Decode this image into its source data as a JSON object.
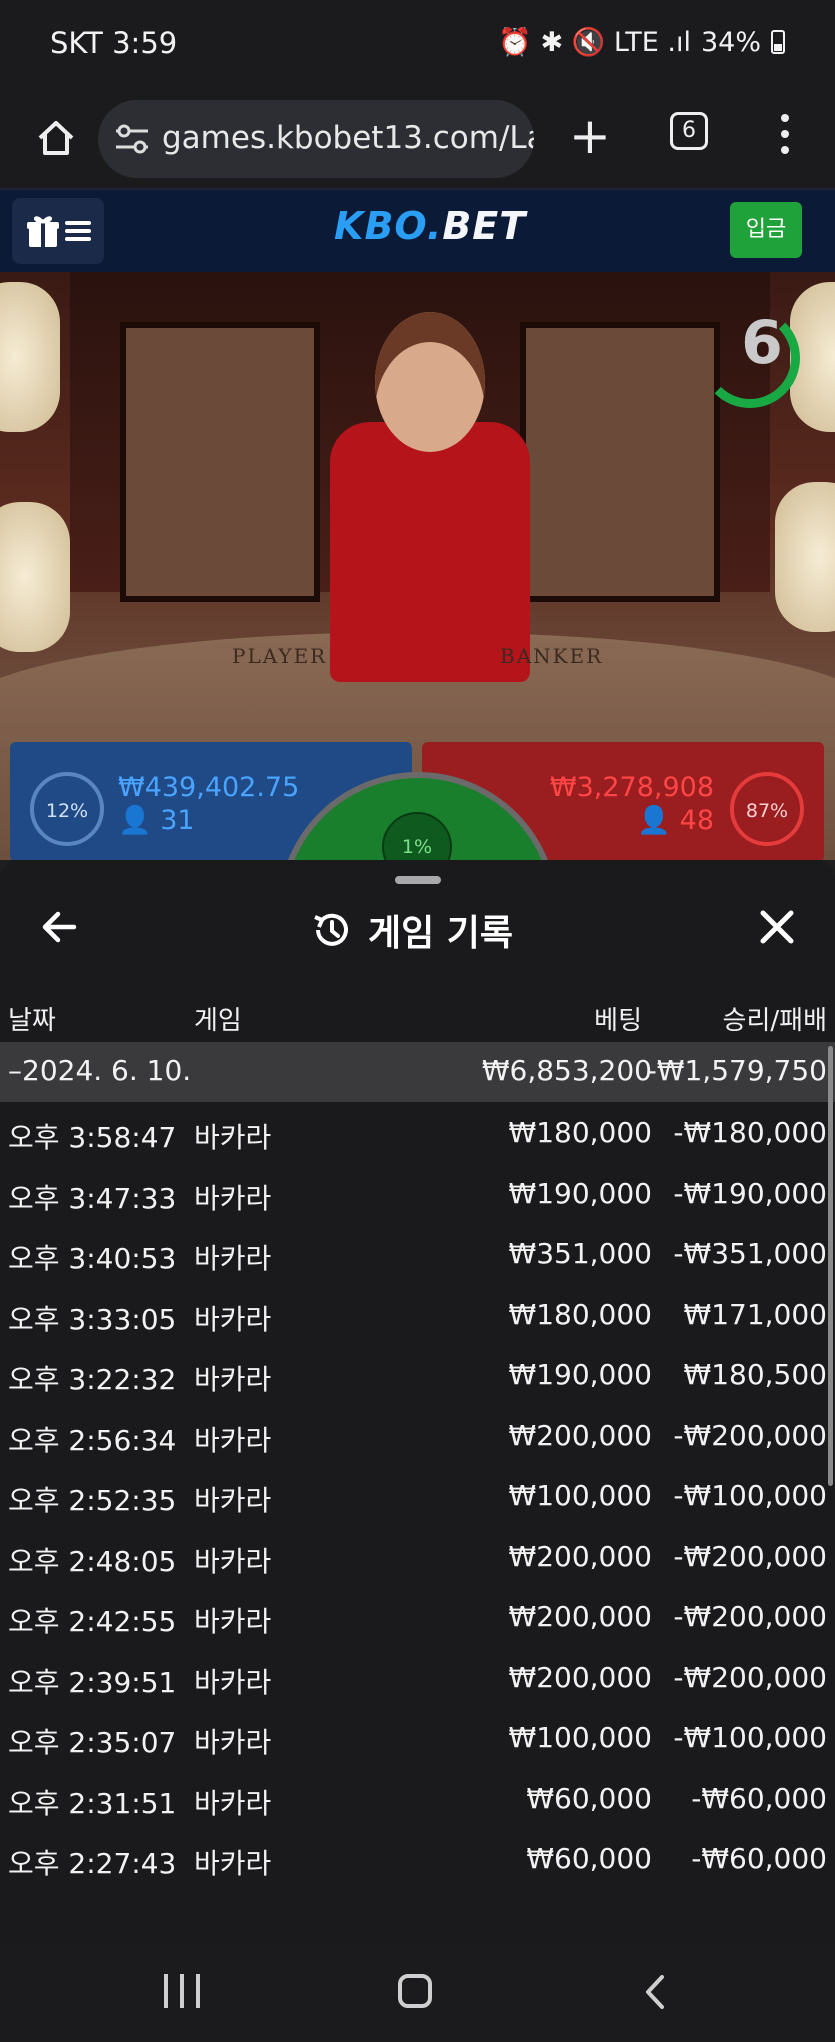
{
  "status_bar": {
    "time": "SKT 3:59",
    "indicators": "⏰ ✱ 🔇 LTE .ıl",
    "battery": "34%"
  },
  "browser": {
    "url": "games.kbobet13.com/La",
    "tab_count": "6",
    "icons": [
      "home-icon",
      "site-settings-icon",
      "plus-icon",
      "tabs-icon",
      "more-vert-icon"
    ]
  },
  "site_header": {
    "logo_part1": "KBO.",
    "logo_part2": "BET",
    "deposit_label": "입금"
  },
  "live_game": {
    "timer": "6",
    "table_player_text": "PLAYER",
    "table_banker_text": "BANKER",
    "player": {
      "pct": "12%",
      "amount": "₩439,402.75",
      "count": "31"
    },
    "banker": {
      "pct": "87%",
      "amount": "₩3,278,908",
      "count": "48"
    },
    "tie": {
      "pct": "1%"
    }
  },
  "history": {
    "title": "게임 기록",
    "columns": {
      "date": "날짜",
      "game": "게임",
      "bet": "베팅",
      "result": "승리/패배"
    },
    "date_group": {
      "date": "–2024. 6. 10.",
      "bet_total": "₩6,853,200",
      "result_total": "-₩1,579,750"
    },
    "rows": [
      {
        "time": "오후 3:58:47",
        "game": "바카라",
        "bet": "₩180,000",
        "result": "-₩180,000"
      },
      {
        "time": "오후 3:47:33",
        "game": "바카라",
        "bet": "₩190,000",
        "result": "-₩190,000"
      },
      {
        "time": "오후 3:40:53",
        "game": "바카라",
        "bet": "₩351,000",
        "result": "-₩351,000"
      },
      {
        "time": "오후 3:33:05",
        "game": "바카라",
        "bet": "₩180,000",
        "result": "₩171,000"
      },
      {
        "time": "오후 3:22:32",
        "game": "바카라",
        "bet": "₩190,000",
        "result": "₩180,500"
      },
      {
        "time": "오후 2:56:34",
        "game": "바카라",
        "bet": "₩200,000",
        "result": "-₩200,000"
      },
      {
        "time": "오후 2:52:35",
        "game": "바카라",
        "bet": "₩100,000",
        "result": "-₩100,000"
      },
      {
        "time": "오후 2:48:05",
        "game": "바카라",
        "bet": "₩200,000",
        "result": "-₩200,000"
      },
      {
        "time": "오후 2:42:55",
        "game": "바카라",
        "bet": "₩200,000",
        "result": "-₩200,000"
      },
      {
        "time": "오후 2:39:51",
        "game": "바카라",
        "bet": "₩200,000",
        "result": "-₩200,000"
      },
      {
        "time": "오후 2:35:07",
        "game": "바카라",
        "bet": "₩100,000",
        "result": "-₩100,000"
      },
      {
        "time": "오후 2:31:51",
        "game": "바카라",
        "bet": "₩60,000",
        "result": "-₩60,000"
      },
      {
        "time": "오후 2:27:43",
        "game": "바카라",
        "bet": "₩60,000",
        "result": "-₩60,000"
      }
    ]
  },
  "colors": {
    "player_blue": "#1f4a86",
    "banker_red": "#9a1d20",
    "tie_green": "#1a7f2c",
    "deposit_green": "#1fa23a",
    "header_navy": "#0b1a36"
  }
}
